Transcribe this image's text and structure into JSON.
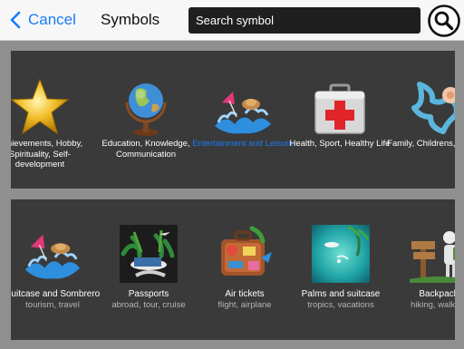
{
  "header": {
    "cancel_label": "Cancel",
    "title": "Symbols",
    "search_placeholder": "Search symbol"
  },
  "categories": [
    {
      "label": "Achievements, Hobby, Spirituality, Self-development",
      "icon": "star-icon"
    },
    {
      "label": "Education, Knowledge, Communication",
      "icon": "globe-icon"
    },
    {
      "label": "Entertainment and Leisure",
      "icon": "water-splash-icon",
      "selected": true
    },
    {
      "label": "Health, Sport, Healthy Life",
      "icon": "first-aid-kit-icon"
    },
    {
      "label": "Family, Childrens, Friends",
      "icon": "pacifier-icon"
    }
  ],
  "symbols": [
    {
      "label": "Suitcase and Sombrero",
      "tags": "tourism, travel",
      "icon": "suitcase-sombrero-icon"
    },
    {
      "label": "Passports",
      "tags": "abroad, tour, cruise",
      "icon": "passports-icon"
    },
    {
      "label": "Air tickets",
      "tags": "flight, airplane",
      "icon": "air-tickets-icon"
    },
    {
      "label": "Palms and suitcase",
      "tags": "tropics, vacations",
      "icon": "palms-suitcase-icon"
    },
    {
      "label": "Backpack",
      "tags": "hiking, walking",
      "icon": "backpack-icon"
    }
  ],
  "colors": {
    "accent": "#1a7cf5",
    "panel": "#3a3a3a",
    "background": "#8f8f8f"
  }
}
